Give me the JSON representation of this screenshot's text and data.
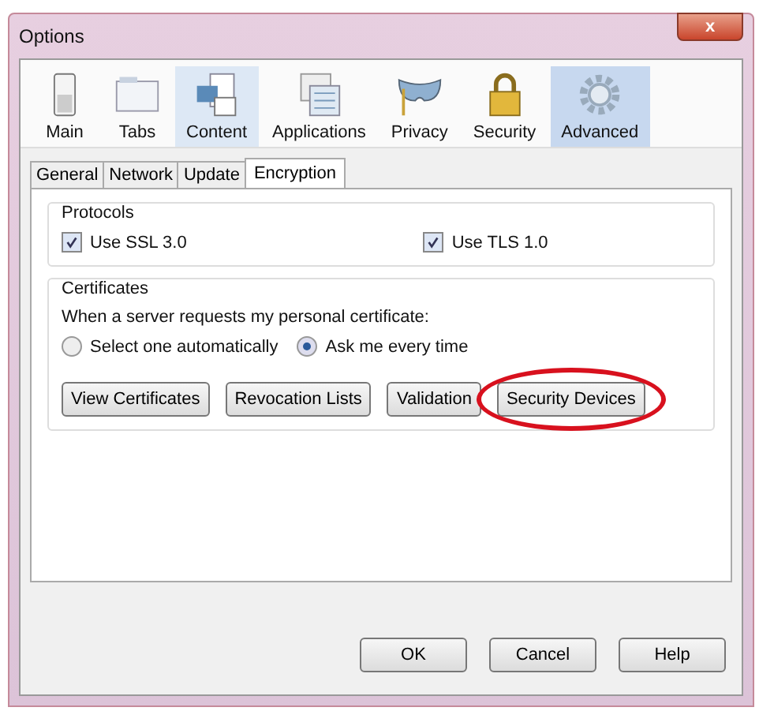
{
  "window": {
    "title": "Options",
    "close": "x"
  },
  "toolbar": [
    {
      "label": "Main",
      "kind": "switch",
      "selected": false,
      "hovered": false
    },
    {
      "label": "Tabs",
      "kind": "window",
      "selected": false,
      "hovered": false
    },
    {
      "label": "Content",
      "kind": "document",
      "selected": false,
      "hovered": true
    },
    {
      "label": "Applications",
      "kind": "calendar",
      "selected": false,
      "hovered": false
    },
    {
      "label": "Privacy",
      "kind": "mask",
      "selected": false,
      "hovered": false
    },
    {
      "label": "Security",
      "kind": "padlock",
      "selected": false,
      "hovered": false
    },
    {
      "label": "Advanced",
      "kind": "gear",
      "selected": true,
      "hovered": false
    }
  ],
  "tabs": [
    {
      "label": "General",
      "selected": false
    },
    {
      "label": "Network",
      "selected": false
    },
    {
      "label": "Update",
      "selected": false
    },
    {
      "label": "Encryption",
      "selected": true
    }
  ],
  "protocols": {
    "title": "Protocols",
    "options": [
      {
        "label": "Use SSL 3.0",
        "checked": true
      },
      {
        "label": "Use TLS 1.0",
        "checked": true
      }
    ]
  },
  "certificates": {
    "title": "Certificates",
    "prompt": "When a server requests my personal certificate:",
    "choices": [
      {
        "label": "Select one automatically",
        "selected": false
      },
      {
        "label": "Ask me every time",
        "selected": true
      }
    ],
    "buttons": [
      {
        "label": "View Certificates",
        "circled": false
      },
      {
        "label": "Revocation Lists",
        "circled": false
      },
      {
        "label": "Validation",
        "circled": false
      },
      {
        "label": "Security Devices",
        "circled": true
      }
    ]
  },
  "footer_buttons": [
    "OK",
    "Cancel",
    "Help"
  ]
}
